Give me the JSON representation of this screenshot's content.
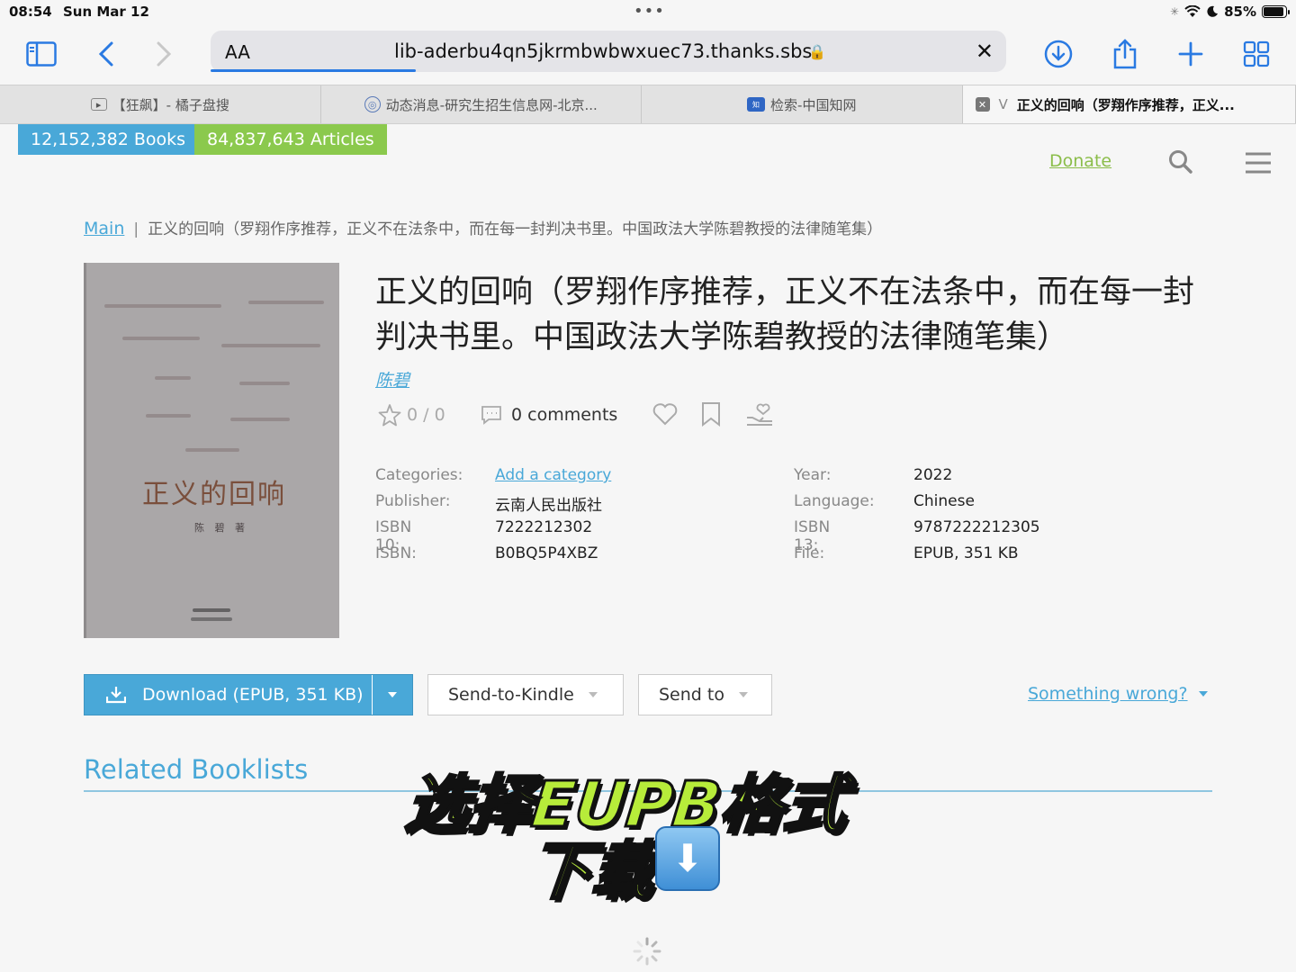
{
  "status": {
    "time": "08:54",
    "date": "Sun Mar 12",
    "dots": "•••",
    "battery": "85%"
  },
  "browser": {
    "aa_label": "AA",
    "url": "lib-aderbu4qn5jkrmbwbwxuec73.thanks.sbs",
    "tabs": [
      {
        "label": "【狂飙】- 橘子盘搜"
      },
      {
        "label": "动态消息-研究生招生信息网-北京..."
      },
      {
        "label": "检索-中国知网"
      },
      {
        "label": "正义的回响（罗翔作序推荐，正义..."
      }
    ]
  },
  "header": {
    "books_badge": "12,152,382 Books",
    "articles_badge": "84,837,643 Articles",
    "donate": "Donate"
  },
  "breadcrumb": {
    "main": "Main",
    "sep": "|",
    "current": "正义的回响（罗翔作序推荐，正义不在法条中，而在每一封判决书里。中国政法大学陈碧教授的法律随笔集）"
  },
  "cover": {
    "title": "正义的回响",
    "author": "陈 碧 著"
  },
  "book": {
    "title": "正义的回响（罗翔作序推荐，正义不在法条中，而在每一封判决书里。中国政法大学陈碧教授的法律随笔集）",
    "author": "陈碧",
    "rating": "0 / 0",
    "comments": "0 comments"
  },
  "properties_left": [
    {
      "label": "Categories:",
      "value": "Add a category",
      "link": true
    },
    {
      "label": "Publisher:",
      "value": "云南人民出版社"
    },
    {
      "label": "ISBN 10:",
      "value": "7222212302"
    },
    {
      "label": "ISBN:",
      "value": "B0BQ5P4XBZ"
    }
  ],
  "properties_right": [
    {
      "label": "Year:",
      "value": "2022"
    },
    {
      "label": "Language:",
      "value": "Chinese"
    },
    {
      "label": "ISBN 13:",
      "value": "9787222212305"
    },
    {
      "label": "File:",
      "value": "EPUB, 351 KB"
    }
  ],
  "actions": {
    "download": "Download (EPUB, 351 KB)",
    "send_kindle": "Send-to-Kindle",
    "send_to": "Send to",
    "something_wrong": "Something wrong?"
  },
  "related": {
    "heading": "Related Booklists"
  },
  "overlay": {
    "line1": "选择EUPB格式",
    "line2": "下载"
  },
  "colors": {
    "accent_blue": "#49a8d8",
    "accent_green": "#8bc94d",
    "caption_green": "#b7ec3a",
    "safari_blue": "#2a7ae2"
  }
}
